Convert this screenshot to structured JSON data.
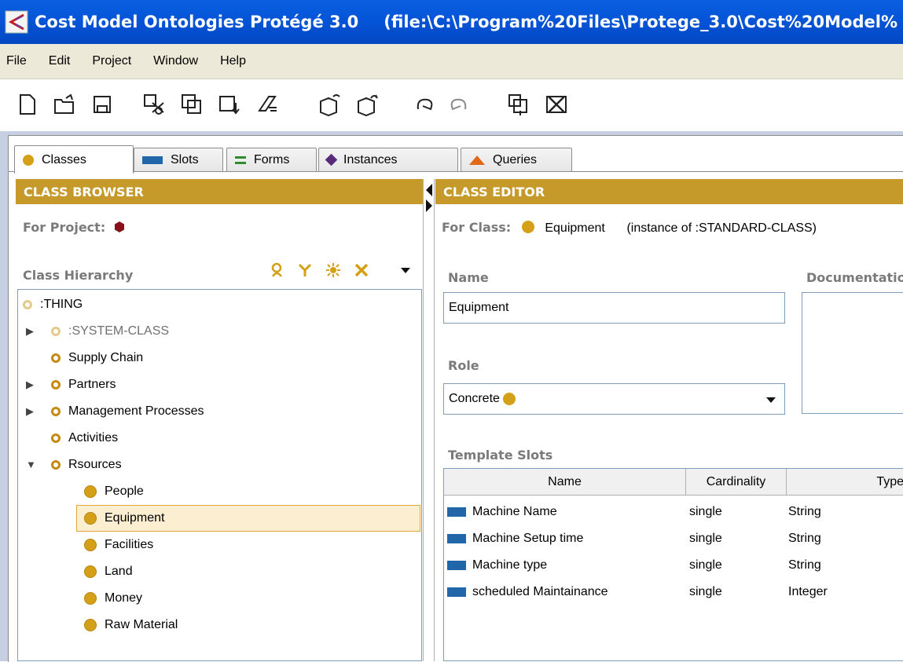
{
  "window": {
    "app_title": "Cost Model Ontologies  Protégé 3.0",
    "path": "(file:\\C:\\Program%20Files\\Protege_3.0\\Cost%20Model%"
  },
  "menu": [
    "File",
    "Edit",
    "Project",
    "Window",
    "Help"
  ],
  "toolbar": {
    "icons": [
      "new-file-icon",
      "open-folder-icon",
      "save-icon",
      "cut-icon",
      "copy-icon",
      "paste-icon",
      "clear-icon",
      "insert-project-icon",
      "include-project-icon",
      "undo-icon",
      "redo-icon",
      "create-instance-icon",
      "delete-icon"
    ]
  },
  "tabs": [
    {
      "label": "Classes",
      "color": "#d4a017",
      "active": true
    },
    {
      "label": "Slots",
      "color": "#2266aa",
      "active": false
    },
    {
      "label": "Forms",
      "color": "#2e8b2e",
      "active": false
    },
    {
      "label": "Instances",
      "color": "#5a2a7a",
      "active": false
    },
    {
      "label": "Queries",
      "color": "#e06a1a",
      "active": false
    }
  ],
  "browser": {
    "header": "CLASS BROWSER",
    "for_project_label": "For Project:",
    "hierarchy_label": "Class Hierarchy",
    "tree": [
      {
        "label": ":THING",
        "kind": "sys"
      },
      {
        "label": ":SYSTEM-CLASS",
        "kind": "sys",
        "toggle": "▶"
      },
      {
        "label": "Supply Chain",
        "kind": "abstract"
      },
      {
        "label": "Partners",
        "kind": "abstract",
        "toggle": "▶"
      },
      {
        "label": "Management Processes",
        "kind": "abstract",
        "toggle": "▶"
      },
      {
        "label": "Activities",
        "kind": "abstract"
      },
      {
        "label": "Rsources",
        "kind": "abstract",
        "toggle": "▼"
      },
      {
        "label": "People",
        "kind": "concrete"
      },
      {
        "label": "Equipment",
        "kind": "concrete",
        "selected": true
      },
      {
        "label": "Facilities",
        "kind": "concrete"
      },
      {
        "label": "Land",
        "kind": "concrete"
      },
      {
        "label": "Money",
        "kind": "concrete"
      },
      {
        "label": "Raw Material",
        "kind": "concrete"
      }
    ]
  },
  "editor": {
    "header": "CLASS EDITOR",
    "for_class_label": "For Class:",
    "class_name": "Equipment",
    "instance_of": "(instance of :STANDARD-CLASS)",
    "name_label": "Name",
    "name_value": "Equipment",
    "documentation_label": "Documentation",
    "role_label": "Role",
    "role_value": "Concrete",
    "template_slots_label": "Template Slots",
    "columns": [
      "Name",
      "Cardinality",
      "Type"
    ],
    "rows": [
      {
        "name": "Machine Name",
        "cardinality": "single",
        "type": "String"
      },
      {
        "name": "Machine Setup time",
        "cardinality": "single",
        "type": "String"
      },
      {
        "name": "Machine type",
        "cardinality": "single",
        "type": "String"
      },
      {
        "name": "scheduled Maintainance",
        "cardinality": "single",
        "type": "Integer"
      }
    ]
  }
}
